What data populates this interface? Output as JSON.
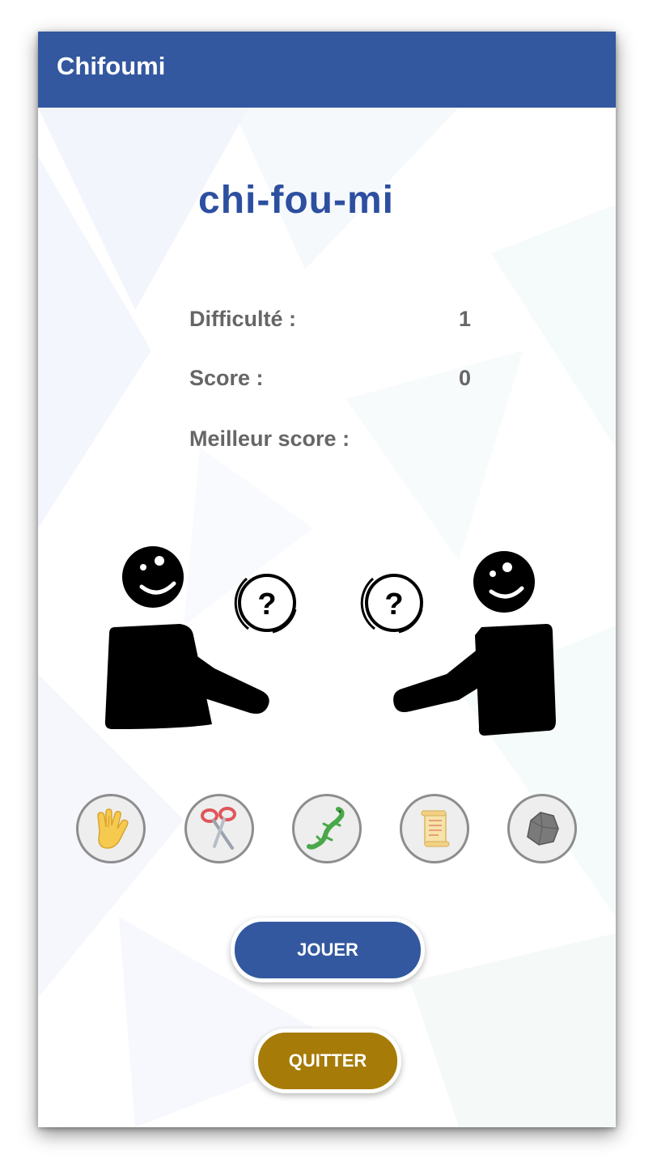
{
  "app": {
    "title": "Chifoumi"
  },
  "logo": {
    "text": "chi-fou-mi"
  },
  "stats": {
    "difficulty_label": "Difficulté :",
    "difficulty_value": "1",
    "score_label": "Score :",
    "score_value": "0",
    "best_label": "Meilleur score :",
    "best_value": ""
  },
  "scene": {
    "player_choice_symbol": "?",
    "opponent_choice_symbol": "?"
  },
  "choices": [
    {
      "id": "spock",
      "icon": "vulcan-salute-icon"
    },
    {
      "id": "scissors",
      "icon": "scissors-icon"
    },
    {
      "id": "lizard",
      "icon": "lizard-icon"
    },
    {
      "id": "paper",
      "icon": "scroll-icon"
    },
    {
      "id": "rock",
      "icon": "rock-icon"
    }
  ],
  "buttons": {
    "play": "JOUER",
    "quit": "QUITTER"
  },
  "colors": {
    "primary": "#3358a0",
    "quit": "#a67b07",
    "stat_text": "#666666"
  }
}
